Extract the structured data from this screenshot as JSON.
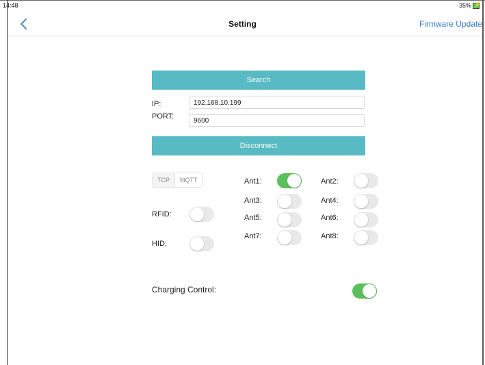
{
  "status_bar": {
    "time": "14:48",
    "battery": "35%"
  },
  "nav": {
    "title": "Setting",
    "action": "Firmware Update"
  },
  "search_button": "Search",
  "ip": {
    "label": "IP:",
    "value": "192.168.10.199"
  },
  "port": {
    "label": "PORT:",
    "value": "9600"
  },
  "disconnect_button": "Disconnect",
  "protocol": {
    "options": [
      "TCP",
      "MQTT"
    ],
    "selected": "TCP"
  },
  "rfid": {
    "label": "RFID:",
    "on": false
  },
  "hid": {
    "label": "HID:",
    "on": false
  },
  "antennas": [
    {
      "label": "Ant1:",
      "on": true
    },
    {
      "label": "Ant2:",
      "on": false
    },
    {
      "label": "Ant3:",
      "on": false
    },
    {
      "label": "Ant4:",
      "on": false
    },
    {
      "label": "Ant5:",
      "on": false
    },
    {
      "label": "Ant6:",
      "on": false
    },
    {
      "label": "Ant7:",
      "on": false
    },
    {
      "label": "Ant8:",
      "on": false
    }
  ],
  "charging_control": {
    "label": "Charging Control:",
    "on": true
  },
  "colors": {
    "accent_bar": "#57bac4",
    "toggle_on": "#5bc05b",
    "link": "#3c7fc2"
  }
}
